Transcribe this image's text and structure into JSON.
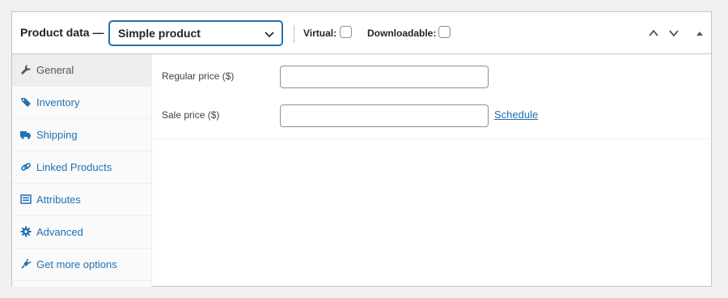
{
  "header": {
    "title": "Product data —",
    "product_type": "Simple product",
    "virtual_label": "Virtual:",
    "virtual_checked": false,
    "downloadable_label": "Downloadable:",
    "downloadable_checked": false,
    "controls": [
      "chevron-up-icon",
      "chevron-down-icon",
      "toggle-arrow-icon"
    ]
  },
  "tabs": [
    {
      "label": "General",
      "icon": "wrench-icon",
      "active": true
    },
    {
      "label": "Inventory",
      "icon": "tag-icon",
      "active": false
    },
    {
      "label": "Shipping",
      "icon": "truck-icon",
      "active": false
    },
    {
      "label": "Linked Products",
      "icon": "link-icon",
      "active": false
    },
    {
      "label": "Attributes",
      "icon": "list-icon",
      "active": false
    },
    {
      "label": "Advanced",
      "icon": "gear-icon",
      "active": false
    },
    {
      "label": "Get more options",
      "icon": "plugin-icon",
      "active": false
    }
  ],
  "general": {
    "regular_price_label": "Regular price ($)",
    "regular_price_value": "",
    "sale_price_label": "Sale price ($)",
    "sale_price_value": "",
    "schedule_link": "Schedule"
  },
  "colors": {
    "accent": "#2271b1",
    "text": "#1d2327",
    "border": "#c3c4c7",
    "background": "#f0f0f1"
  }
}
